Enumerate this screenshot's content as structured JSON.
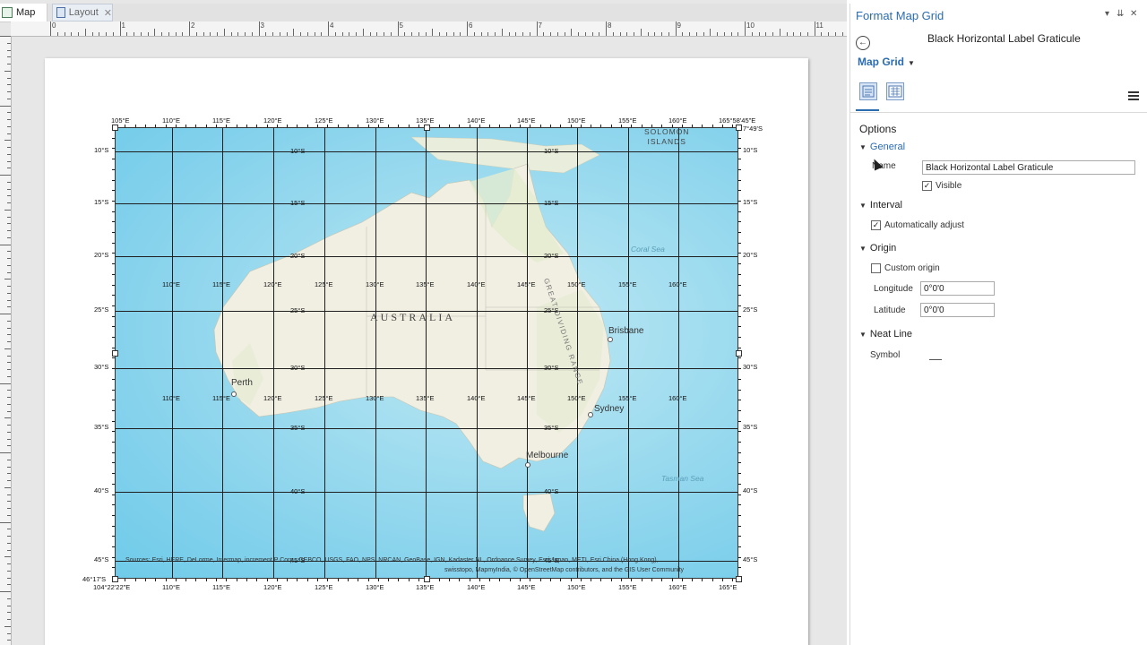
{
  "tabs": [
    {
      "label": "Map"
    },
    {
      "label": "Layout",
      "close": "✕"
    }
  ],
  "ruler": {
    "h": [
      "0",
      "1",
      "2",
      "3",
      "4",
      "5",
      "6",
      "7",
      "8",
      "9",
      "10",
      "11"
    ]
  },
  "map": {
    "top_lon": [
      "105°E",
      "110°E",
      "115°E",
      "120°E",
      "125°E",
      "130°E",
      "135°E",
      "140°E",
      "145°E",
      "150°E",
      "155°E",
      "160°E",
      "165°58'45\"E"
    ],
    "bottom_lon": [
      "104°22'22\"E",
      "110°E",
      "115°E",
      "120°E",
      "125°E",
      "130°E",
      "135°E",
      "140°E",
      "145°E",
      "150°E",
      "155°E",
      "160°E",
      "165°E"
    ],
    "inner_lon": [
      "110°E",
      "115°E",
      "120°E",
      "125°E",
      "130°E",
      "135°E",
      "140°E",
      "145°E",
      "150°E",
      "155°E",
      "160°E"
    ],
    "lat": [
      "10°S",
      "15°S",
      "20°S",
      "25°S",
      "30°S",
      "35°S",
      "40°S",
      "45°S"
    ],
    "top_right_corner": "7°49'S",
    "bottom_left_corner": "46°17'S",
    "country": "AUSTRALIA",
    "islands": "SOLOMON\nISLANDS",
    "range": "GREAT DIVIDING RANGE",
    "cities": [
      {
        "name": "Perth"
      },
      {
        "name": "Brisbane"
      },
      {
        "name": "Sydney"
      },
      {
        "name": "Melbourne"
      }
    ],
    "seas": [
      {
        "name": "Coral Sea"
      },
      {
        "name": "Tasman Sea"
      }
    ],
    "credits_line1": "Sources: Esri, HERE, DeLorme, Intermap, increment P Corp., GEBCO, USGS, FAO, NPS, NRCAN, GeoBase, IGN, Kadaster NL, Ordnance Survey, Esri Japan, METI, Esri China (Hong Kong),",
    "credits_line2": "swisstopo, MapmyIndia, © OpenStreetMap contributors, and the GIS User Community"
  },
  "pane": {
    "title": "Format Map Grid",
    "controls": {
      "dropdown": "▾",
      "pin": "⇊",
      "close": "✕"
    },
    "element_name": "Black Horizontal Label Graticule",
    "dropdown_label": "Map Grid",
    "sections": {
      "options": "Options",
      "general": "General",
      "interval": "Interval",
      "origin": "Origin",
      "neatline": "Neat Line"
    },
    "general": {
      "name_label": "Name",
      "name_value": "Black Horizontal Label Graticule",
      "visible_label": "Visible",
      "visible_checked": true
    },
    "interval": {
      "auto_label": "Automatically adjust",
      "auto_checked": true
    },
    "origin": {
      "custom_label": "Custom origin",
      "custom_checked": false,
      "longitude_label": "Longitude",
      "longitude_value": "0°0'0",
      "latitude_label": "Latitude",
      "latitude_value": "0°0'0"
    },
    "neatline": {
      "symbol_label": "Symbol"
    }
  }
}
